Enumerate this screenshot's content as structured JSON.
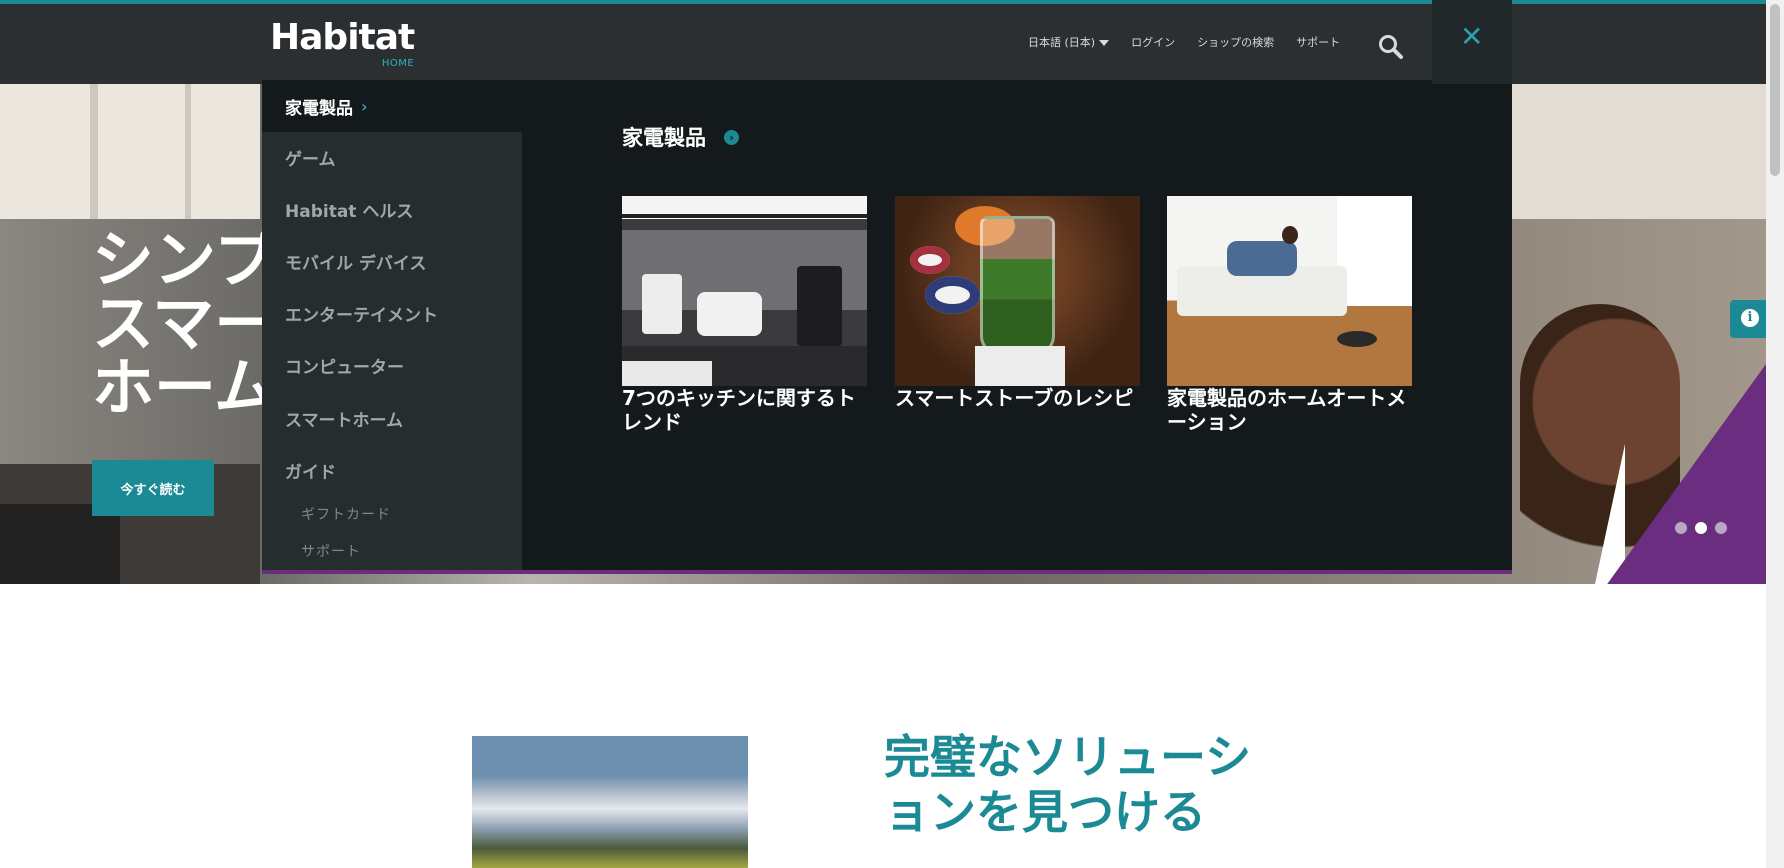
{
  "header": {
    "logo_text": "Habitat",
    "logo_sub": "HOME",
    "nav": [
      "日本語 (日本)",
      "ログイン",
      "ショップの検索",
      "サポート"
    ]
  },
  "hero": {
    "title_line1": "シンプ",
    "title_line2": "スマー",
    "title_line3": "ホーム",
    "cta": "今すぐ読む",
    "slide_active": 2,
    "slide_count": 3
  },
  "mega_menu": {
    "active": "家電製品",
    "items": [
      "家電製品",
      "ゲーム",
      "Habitat ヘルス",
      "モバイル デバイス",
      "エンターテイメント",
      "コンピューター",
      "スマートホーム",
      "ガイド"
    ],
    "sub_items": [
      "ギフトカード",
      "サポート"
    ],
    "category_title": "家電製品",
    "cards": [
      {
        "caption": "7つのキッチンに関するトレンド"
      },
      {
        "caption": "スマートストーブのレシピ"
      },
      {
        "caption": "家電製品のホームオートメーション"
      }
    ]
  },
  "lower": {
    "title": "完璧なソリューションを見つける"
  },
  "colors": {
    "accent": "#1c8a94",
    "purple": "#6a2d7f",
    "header_bg": "#2b2f31",
    "menu_bg": "#141a1b"
  },
  "icons": {
    "search": "search-icon",
    "close": "close-icon",
    "info": "info-icon",
    "chevron": "chevron-right-icon"
  }
}
